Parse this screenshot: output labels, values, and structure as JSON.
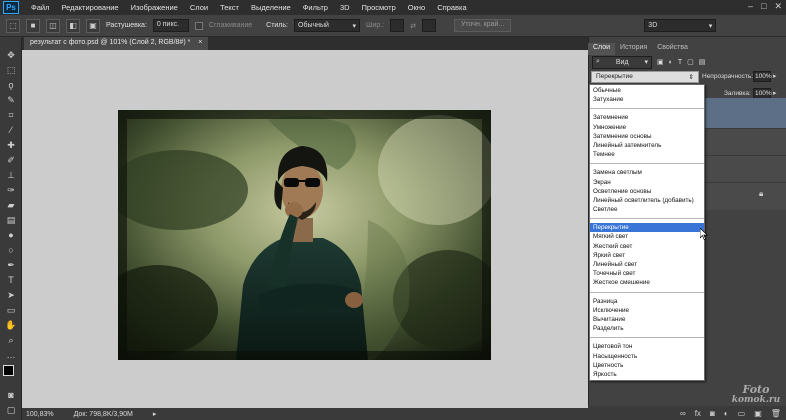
{
  "menubar": {
    "logo": "Ps",
    "items": [
      "Файл",
      "Редактирование",
      "Изображение",
      "Слои",
      "Текст",
      "Выделение",
      "Фильтр",
      "3D",
      "Просмотр",
      "Окно",
      "Справка"
    ]
  },
  "options": {
    "feather_label": "Растушевка:",
    "feather_value": "0 пикс.",
    "antialias_label": "Сглаживание",
    "style_label": "Стиль:",
    "style_value": "Обычный",
    "width_label": "Шир.:",
    "refine_button": "Уточн. край...",
    "workspace_value": "3D"
  },
  "document": {
    "tab_title": "результат с фото.psd @ 101% (Слой 2, RGB/8#) *",
    "zoom": "100,83%",
    "doc_size": "Док: 798,8K/3,90M"
  },
  "panel": {
    "tabs": [
      "Слои",
      "История",
      "Свойства"
    ],
    "filter_label": "Вид",
    "blend_mode": "Перекрытие",
    "opacity_label": "Непрозрачность:",
    "opacity_value": "100%",
    "fill_label": "Заливка:",
    "fill_value": "100%"
  },
  "blend_groups": [
    [
      "Обычные",
      "Затухание"
    ],
    [
      "Затемнение",
      "Умножение",
      "Затемнение основы",
      "Линейный затемнитель",
      "Темнее"
    ],
    [
      "Замена светлым",
      "Экран",
      "Осветление основы",
      "Линейный осветлитель (добавить)",
      "Светлее"
    ],
    [
      "Перекрытие",
      "Мягкий свет",
      "Жесткий свет",
      "Яркий свет",
      "Линейный свет",
      "Точечный свет",
      "Жесткое смешение"
    ],
    [
      "Разница",
      "Исключение",
      "Вычитание",
      "Разделить"
    ],
    [
      "Цветовой тон",
      "Насыщенность",
      "Цветность",
      "Яркость"
    ]
  ],
  "watermark": {
    "line1": "Foto",
    "line2": "komok.ru"
  }
}
